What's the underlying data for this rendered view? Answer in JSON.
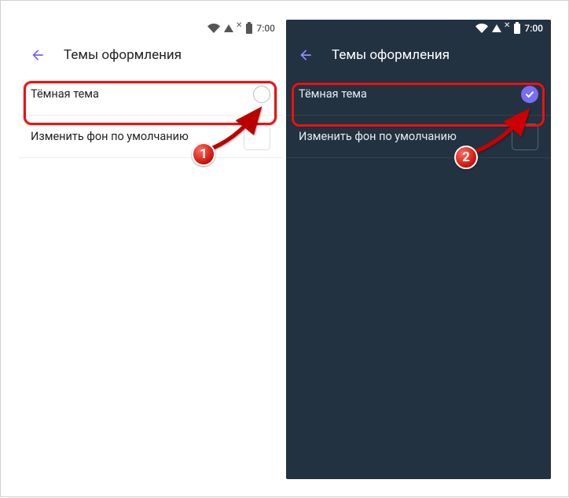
{
  "status": {
    "time": "7:00"
  },
  "header": {
    "title": "Темы оформления"
  },
  "rows": {
    "dark_theme": "Тёмная тема",
    "change_bg": "Изменить фон по умолчанию"
  },
  "badges": {
    "b1": "1",
    "b2": "2"
  },
  "colors": {
    "accent": "#7360f2",
    "highlight": "#e11",
    "dark_bg": "#223241"
  }
}
